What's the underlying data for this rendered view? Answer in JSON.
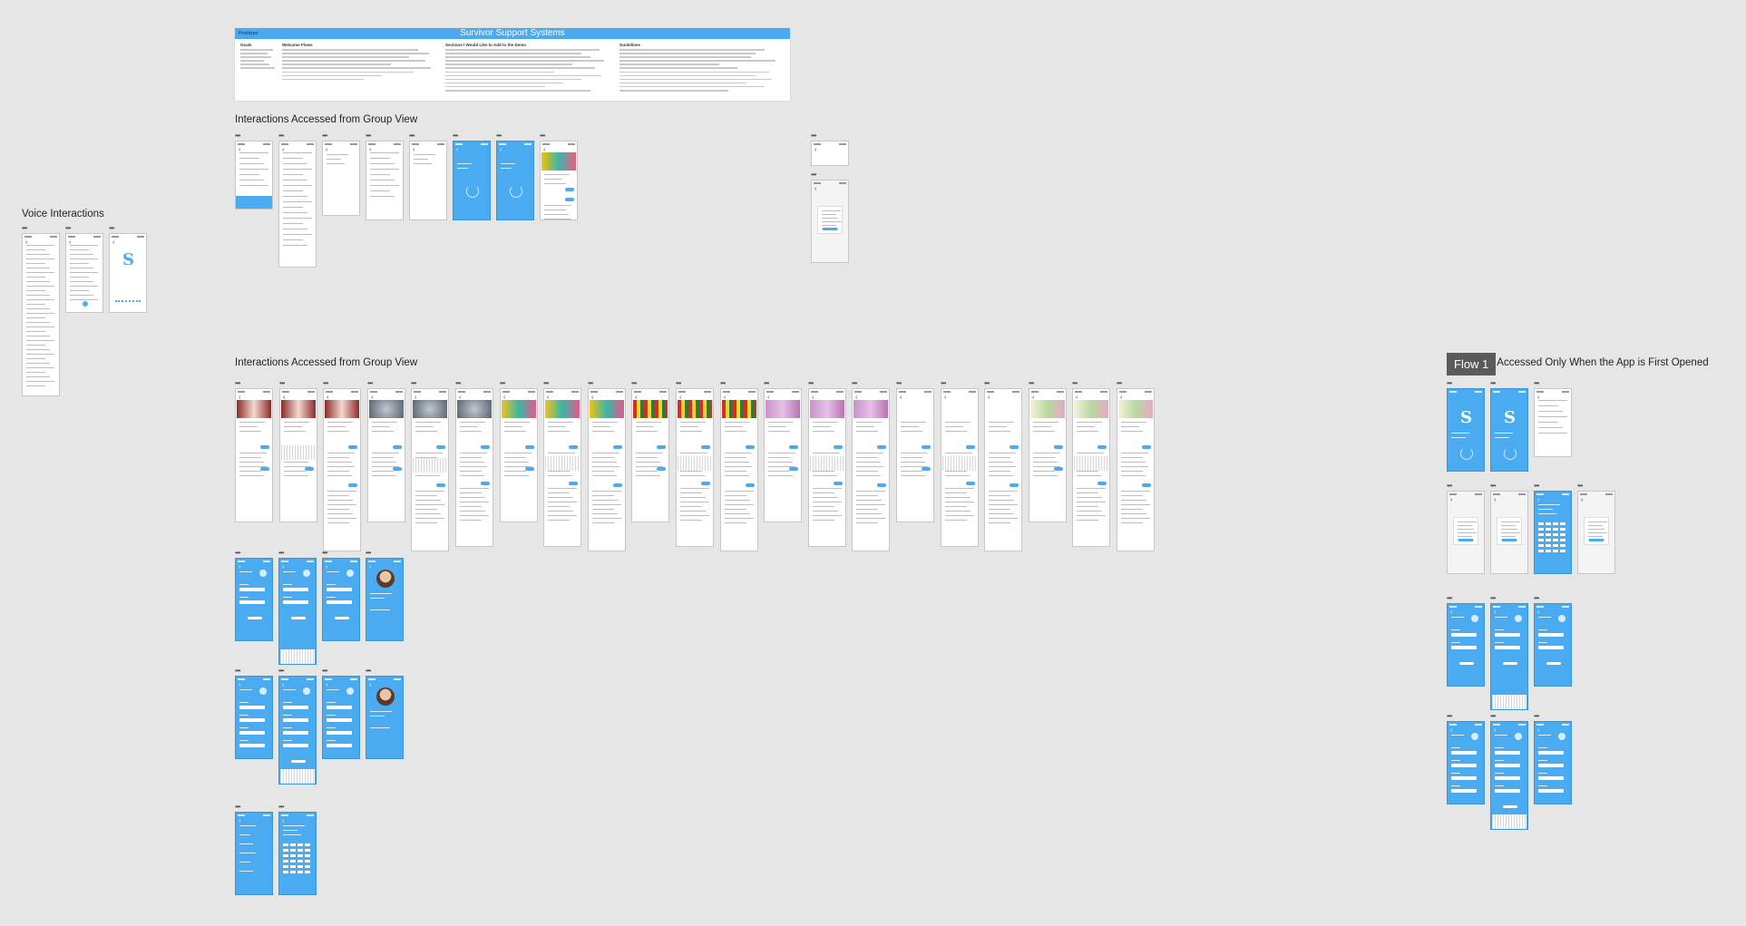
{
  "doc": {
    "title": "Survivor Support Systems",
    "tag": "Prototype",
    "columns": [
      {
        "heading": "Goals",
        "lines": 6
      },
      {
        "heading": "Welcome Flows",
        "lines": 9
      },
      {
        "heading": "Sections I Would Like to Add to the Demo",
        "lines": 12
      },
      {
        "heading": "Guidelines",
        "lines": 12
      }
    ]
  },
  "labels": {
    "voice": "Voice Interactions",
    "group_top": "Interactions Accessed from Group View",
    "group_mid": "Interactions Accessed from Group View",
    "first_opened": "s Accessed Only When the App is First Opened",
    "flow_tag": "Flow 1"
  },
  "artboard_dots": "•••",
  "splash_logo": "S",
  "colors": {
    "brand_blue": "#4aabf1",
    "canvas": "#e6e6e6",
    "doc_bar": "#4aa9f0"
  }
}
